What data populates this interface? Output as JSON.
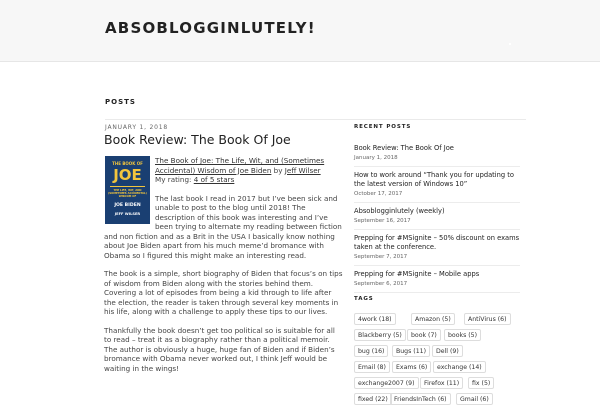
{
  "site": {
    "title": "ABSOBLOGGINLUTELY!"
  },
  "page": {
    "heading": "POSTS"
  },
  "post": {
    "date": "JANUARY 1, 2018",
    "title": "Book Review: The Book Of Joe",
    "book_link": "The Book of Joe: The Life, Wit, and (Sometimes Accidental) Wisdom of Joe Biden",
    "by": " by ",
    "author": "Jeff Wilser",
    "rating_label": "My rating: ",
    "rating": "4 of 5 stars",
    "cover": {
      "small_top": "THE BOOK OF",
      "big": "JOE",
      "subtitle": "THE LIFE, WIT, AND (SOMETIMES ACCIDENTAL) WISDOM OF",
      "name": "JOE BIDEN",
      "author": "JEFF WILSER",
      "bg_color": "#1a3f72",
      "accent_color": "#f2c53d"
    },
    "paragraphs": [
      "The last book I read in 2017 but I’ve been sick and unable to post to the blog until 2018!  The description of this book was interesting and I’ve been trying to alternate my reading between fiction and non fiction and as a Brit in the USA I basically know nothing about Joe Biden apart from his much meme’d bromance with Obama so I figured this might make an interesting read.",
      "The book is a simple, short biography of Biden that focus’s on tips of wisdom from Biden along with the stories behind them. Covering a lot of episodes from being a kid through to life after the election, the reader is taken through several key moments in his life, along with a challenge to apply these tips to our lives.",
      "Thankfully the book doesn’t get too political so is suitable for all to read – treat it as a biography rather than a political memoir.  The author is obviously a huge, huge fan of Biden and if Biden’s bromance with Obama never worked out, I think Jeff would be waiting in the wings!"
    ]
  },
  "sidebar": {
    "recent_heading": "RECENT POSTS",
    "recent_posts": [
      {
        "title": "Book Review: The Book Of Joe",
        "date": "January 1, 2018"
      },
      {
        "title": "How to work around “Thank you for updating to the latest version of Windows 10”",
        "date": "October 17, 2017"
      },
      {
        "title": "Absoblogginlutely (weekly)",
        "date": "September 16, 2017"
      },
      {
        "title": "Prepping for #MSignite – 50% discount on exams taken at the conference.",
        "date": "September 7, 2017"
      },
      {
        "title": "Prepping for #MSignite – Mobile apps",
        "date": "September 6, 2017"
      }
    ],
    "tags_heading": "TAGS",
    "tags": [
      "4work (18)",
      "Amazon (5)",
      "AntiVirus (6)",
      "Blackberry (5)",
      "book (7)",
      "books (5)",
      "bug (16)",
      "Bugs (11)",
      "Dell (9)",
      "Email (8)",
      "Exams (6)",
      "exchange (14)",
      "exchange2007 (9)",
      "Firefox (11)",
      "fix (5)",
      "fixed (22)",
      "FriendsInTech (6)",
      "Gmail (6)"
    ]
  }
}
